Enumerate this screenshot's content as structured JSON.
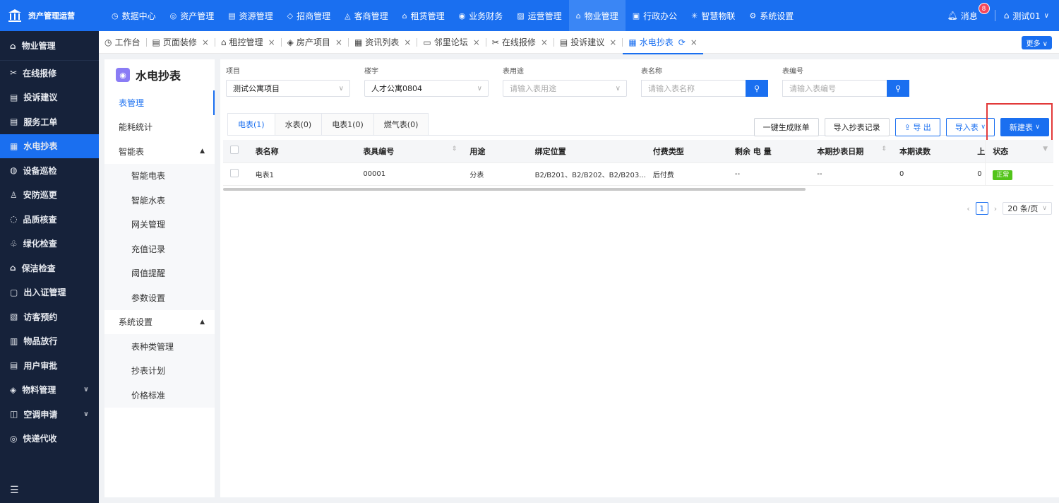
{
  "app": {
    "logo_text": "资产管理运营"
  },
  "topnav": [
    {
      "icon": "◷",
      "label": "数据中心"
    },
    {
      "icon": "◎",
      "label": "资产管理"
    },
    {
      "icon": "▤",
      "label": "资源管理"
    },
    {
      "icon": "◇",
      "label": "招商管理"
    },
    {
      "icon": "◬",
      "label": "客商管理"
    },
    {
      "icon": "⌂",
      "label": "租赁管理"
    },
    {
      "icon": "◉",
      "label": "业务财务"
    },
    {
      "icon": "▨",
      "label": "运营管理"
    },
    {
      "icon": "⌂",
      "label": "物业管理"
    },
    {
      "icon": "▣",
      "label": "行政办公"
    },
    {
      "icon": "✳",
      "label": "智慧物联"
    },
    {
      "icon": "⚙",
      "label": "系统设置"
    }
  ],
  "topright": {
    "messages_label": "消息",
    "messages_badge": "8",
    "user_label": "测试01"
  },
  "sidebar": {
    "header": "物业管理",
    "items": [
      {
        "icon": "✂",
        "label": "在线报修"
      },
      {
        "icon": "▤",
        "label": "投诉建议"
      },
      {
        "icon": "▤",
        "label": "服务工单"
      },
      {
        "icon": "▦",
        "label": "水电抄表"
      },
      {
        "icon": "◍",
        "label": "设备巡检"
      },
      {
        "icon": "♙",
        "label": "安防巡更"
      },
      {
        "icon": "◌",
        "label": "品质核查"
      },
      {
        "icon": "♧",
        "label": "绿化检查"
      },
      {
        "icon": "⌂",
        "label": "保洁检查"
      },
      {
        "icon": "▢",
        "label": "出入证管理"
      },
      {
        "icon": "▧",
        "label": "访客预约"
      },
      {
        "icon": "▥",
        "label": "物品放行"
      },
      {
        "icon": "▤",
        "label": "用户审批"
      },
      {
        "icon": "◈",
        "label": "物料管理"
      },
      {
        "icon": "◫",
        "label": "空调申请"
      },
      {
        "icon": "◎",
        "label": "快递代收"
      }
    ]
  },
  "tabs": [
    {
      "icon": "◷",
      "label": "工作台"
    },
    {
      "icon": "▤",
      "label": "页面装修"
    },
    {
      "icon": "⌂",
      "label": "租控管理"
    },
    {
      "icon": "◈",
      "label": "房产项目"
    },
    {
      "icon": "▦",
      "label": "资讯列表"
    },
    {
      "icon": "▭",
      "label": "邻里论坛"
    },
    {
      "icon": "✂",
      "label": "在线报修"
    },
    {
      "icon": "▤",
      "label": "投诉建议"
    },
    {
      "icon": "▦",
      "label": "水电抄表"
    }
  ],
  "more_label": "更多",
  "leftpanel": {
    "title": "水电抄表",
    "items": [
      {
        "label": "表管理"
      },
      {
        "label": "能耗统计"
      },
      {
        "label": "智能表"
      },
      {
        "label": "智能电表"
      },
      {
        "label": "智能水表"
      },
      {
        "label": "网关管理"
      },
      {
        "label": "充值记录"
      },
      {
        "label": "阈值提醒"
      },
      {
        "label": "参数设置"
      },
      {
        "label": "系统设置"
      },
      {
        "label": "表种类管理"
      },
      {
        "label": "抄表计划"
      },
      {
        "label": "价格标准"
      }
    ]
  },
  "filters": {
    "project_label": "项目",
    "project_value": "测试公寓项目",
    "building_label": "楼宇",
    "building_value": "人才公寓0804",
    "usage_label": "表用途",
    "usage_placeholder": "请输入表用途",
    "name_label": "表名称",
    "name_placeholder": "请输入表名称",
    "code_label": "表编号",
    "code_placeholder": "请输入表编号"
  },
  "subtabs": [
    "电表(1)",
    "水表(0)",
    "电表1(0)",
    "燃气表(0)"
  ],
  "actions": {
    "generate": "一键生成账单",
    "import_records": "导入抄表记录",
    "export": "导 出",
    "import_meter": "导入表",
    "new_meter": "新建表"
  },
  "table": {
    "headers": [
      "表名称",
      "表具编号",
      "用途",
      "绑定位置",
      "付费类型",
      "剩余 电 量",
      "本期抄表日期",
      "本期读数",
      "上",
      "状态"
    ],
    "rows": [
      [
        "电表1",
        "00001",
        "分表",
        "B2/B201、B2/B202、B2/B203...",
        "后付费",
        "--",
        "--",
        "0",
        "0",
        "正常"
      ]
    ]
  },
  "pager": {
    "current": "1",
    "page_size": "20 条/页"
  },
  "colors": {
    "primary": "#1a6ff0",
    "sidebar_bg": "#16223a",
    "status_ok": "#52c41a",
    "highlight": "#e23a3a"
  }
}
